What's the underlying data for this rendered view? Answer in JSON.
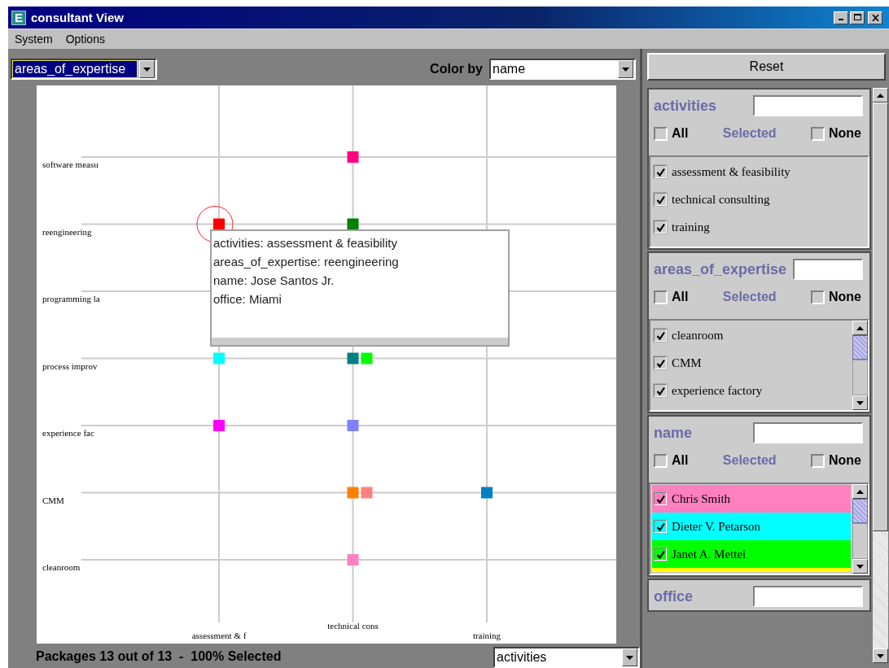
{
  "window": {
    "title": "consultant View",
    "icon_letter": "E"
  },
  "menu": [
    "System",
    "Options"
  ],
  "y_axis_select": {
    "value": "areas_of_expertise"
  },
  "color_by": {
    "label": "Color by",
    "value": "name"
  },
  "chart": {
    "rows": [
      {
        "label": "software measu",
        "cells": [
          [],
          [
            {
              "color": "#ff0080",
              "selected": false
            }
          ],
          []
        ]
      },
      {
        "label": "reengineering",
        "cells": [
          [
            {
              "color": "#ff0000",
              "selected": true
            }
          ],
          [
            {
              "color": "#008000",
              "selected": false
            }
          ],
          []
        ]
      },
      {
        "label": "programming la",
        "cells": [
          [],
          [],
          []
        ]
      },
      {
        "label": "process improv",
        "cells": [
          [
            {
              "color": "#00ffff",
              "selected": false
            }
          ],
          [
            {
              "color": "#008080",
              "selected": false
            },
            {
              "color": "#00ff00",
              "selected": false
            }
          ],
          []
        ]
      },
      {
        "label": "experience fac",
        "cells": [
          [
            {
              "color": "#ff00ff",
              "selected": false
            }
          ],
          [
            {
              "color": "#8080ff",
              "selected": false
            }
          ],
          []
        ]
      },
      {
        "label": "CMM",
        "cells": [
          [],
          [
            {
              "color": "#ff8000",
              "selected": false
            },
            {
              "color": "#ff8080",
              "selected": false
            }
          ],
          [
            {
              "color": "#0080c0",
              "selected": false
            }
          ]
        ]
      },
      {
        "label": "cleanroom",
        "cells": [
          [],
          [
            {
              "color": "#ff80c0",
              "selected": false
            }
          ],
          []
        ]
      }
    ],
    "columns": [
      "assessment & f",
      "technical cons",
      "training"
    ],
    "tooltip": {
      "lines": [
        "activities: assessment & feasibility",
        "areas_of_expertise: reengineering",
        "name: Jose Santos Jr.",
        "office: Miami"
      ]
    }
  },
  "status": {
    "text": "Packages 13 out of 13  -  100% Selected"
  },
  "x_axis_select": {
    "value": "activities"
  },
  "reset_button": "Reset",
  "filters": [
    {
      "title": "activities",
      "all_label": "All",
      "all_checked": false,
      "selected_label": "Selected",
      "none_label": "None",
      "none_checked": false,
      "scrollable": false,
      "items": [
        {
          "label": "assessment & feasibility",
          "checked": true
        },
        {
          "label": "technical consulting",
          "checked": true
        },
        {
          "label": "training",
          "checked": true
        }
      ]
    },
    {
      "title": "areas_of_expertise",
      "all_label": "All",
      "all_checked": false,
      "selected_label": "Selected",
      "none_label": "None",
      "none_checked": false,
      "scrollable": true,
      "items": [
        {
          "label": "cleanroom",
          "checked": true
        },
        {
          "label": "CMM",
          "checked": true
        },
        {
          "label": "experience factory",
          "checked": true
        }
      ]
    },
    {
      "title": "name",
      "all_label": "All",
      "all_checked": false,
      "selected_label": "Selected",
      "none_label": "None",
      "none_checked": false,
      "scrollable": true,
      "items": [
        {
          "label": "Chris Smith",
          "checked": true,
          "color": "#ff80c0"
        },
        {
          "label": "Dieter V. Petarson",
          "checked": true,
          "color": "#00ffff"
        },
        {
          "label": "Janet A. Mettei",
          "checked": true,
          "color": "#00ff00"
        },
        {
          "color": "#ffff00"
        }
      ]
    },
    {
      "title": "office"
    }
  ]
}
